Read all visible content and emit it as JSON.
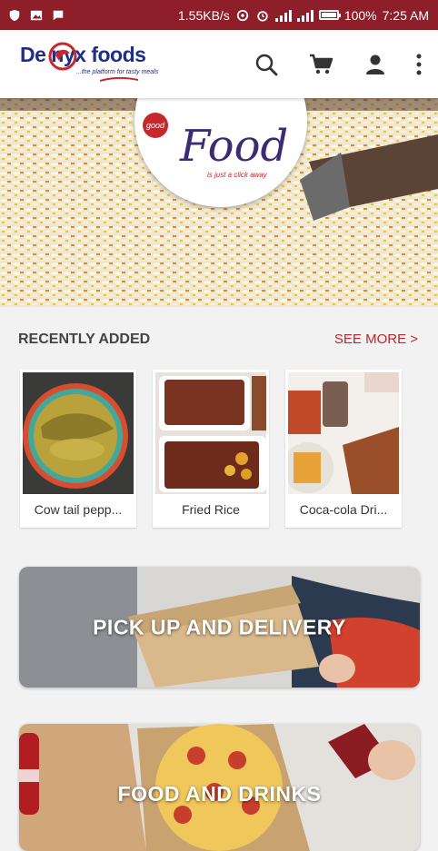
{
  "status_bar": {
    "net_speed": "1.55KB/s",
    "battery": "100%",
    "time": "7:25 AM",
    "battery_level": 1.0
  },
  "app_bar": {
    "logo_text": "De  nyx foods",
    "logo_tagline": "...the platform for tasty meals",
    "icons": [
      "search-icon",
      "cart-icon",
      "account-icon",
      "more-icon"
    ]
  },
  "hero": {
    "badge_good": "good",
    "badge_title": "Food",
    "badge_subtitle": "is just a click away"
  },
  "recently_added": {
    "title": "RECENTLY ADDED",
    "see_more": "SEE MORE >",
    "items": [
      {
        "label": "Cow tail pepp..."
      },
      {
        "label": "Fried Rice"
      },
      {
        "label": "Coca-cola Dri..."
      }
    ]
  },
  "banners": [
    {
      "label": "PICK UP AND DELIVERY"
    },
    {
      "label": "FOOD AND DRINKS"
    }
  ],
  "colors": {
    "status_bar": "#8e1f2a",
    "brand_blue": "#1f2e8a",
    "brand_red": "#c6282e",
    "see_more": "#b8282e"
  }
}
